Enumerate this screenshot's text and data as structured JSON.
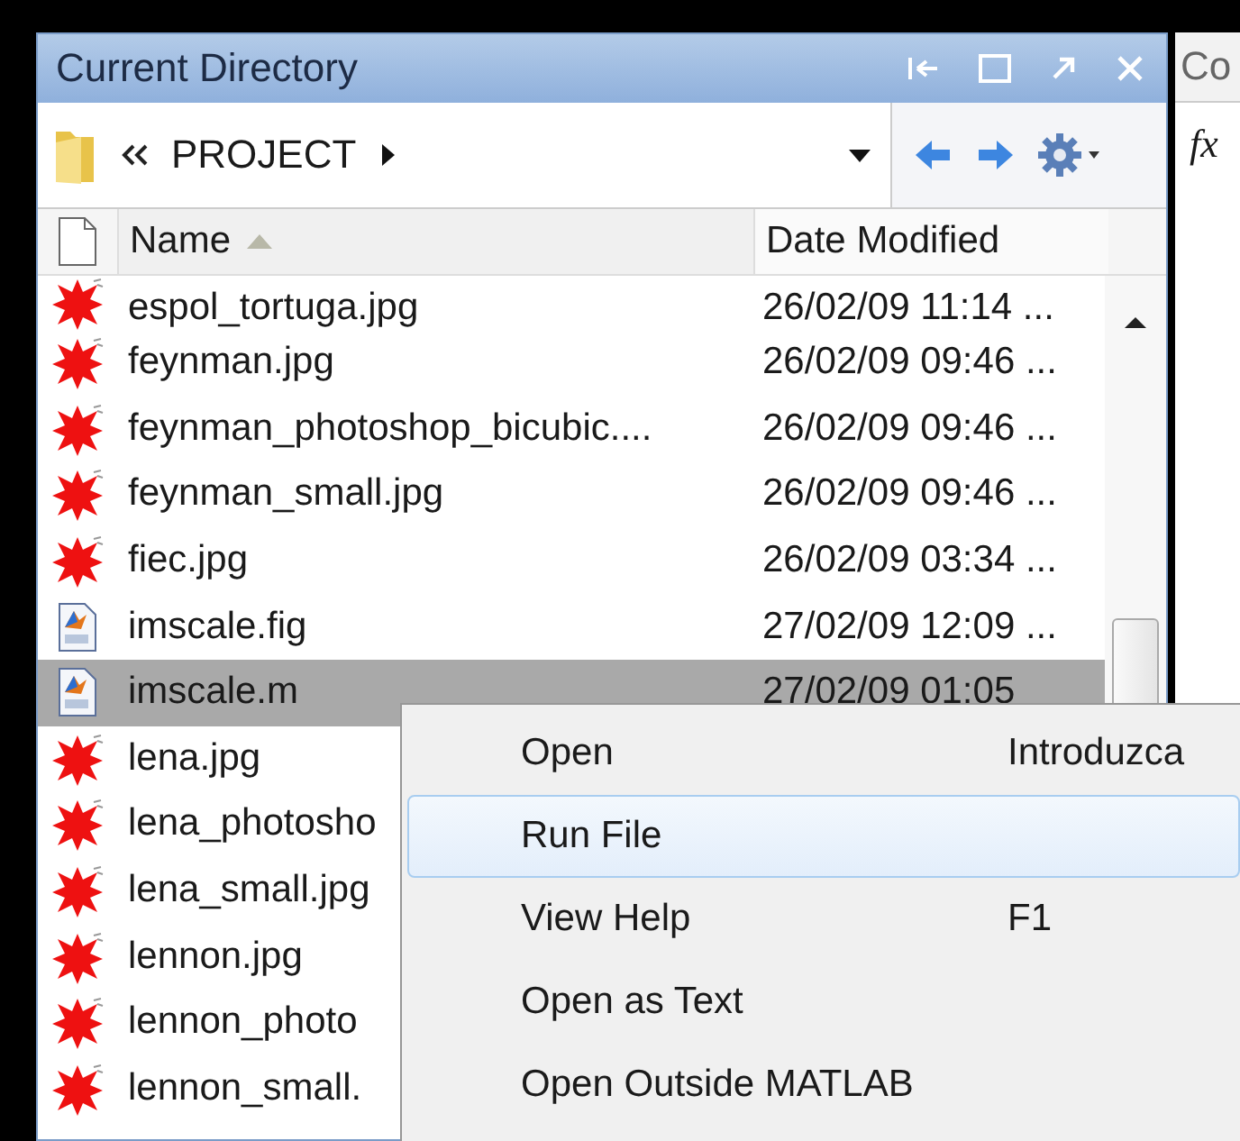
{
  "panel": {
    "title": "Current Directory"
  },
  "address": {
    "path": "PROJECT"
  },
  "columns": [
    {
      "label": "Name",
      "sorted": true
    },
    {
      "label": "Date Modified",
      "sorted": false
    }
  ],
  "rows": [
    {
      "name": "espol_tortuga.jpg",
      "date": "26/02/09 11:14 ...",
      "kind": "image",
      "selected": false
    },
    {
      "name": "feynman.jpg",
      "date": "26/02/09 09:46 ...",
      "kind": "image",
      "selected": false
    },
    {
      "name": "feynman_photoshop_bicubic....",
      "date": "26/02/09 09:46 ...",
      "kind": "image",
      "selected": false
    },
    {
      "name": "feynman_small.jpg",
      "date": "26/02/09 09:46 ...",
      "kind": "image",
      "selected": false
    },
    {
      "name": "fiec.jpg",
      "date": "26/02/09 03:34 ...",
      "kind": "image",
      "selected": false
    },
    {
      "name": "imscale.fig",
      "date": "27/02/09 12:09 ...",
      "kind": "matlab",
      "selected": false
    },
    {
      "name": "imscale.m",
      "date": "27/02/09 01:05",
      "kind": "matlab",
      "selected": true
    },
    {
      "name": "lena.jpg",
      "kind": "image",
      "selected": false
    },
    {
      "name": "lena_photosho",
      "kind": "image",
      "selected": false
    },
    {
      "name": "lena_small.jpg",
      "kind": "image",
      "selected": false
    },
    {
      "name": "lennon.jpg",
      "kind": "image",
      "selected": false
    },
    {
      "name": "lennon_photo",
      "kind": "image",
      "selected": false
    },
    {
      "name": "lennon_small.",
      "kind": "image",
      "selected": false
    }
  ],
  "side_panel": {
    "title": "Co",
    "symbol": "fx"
  },
  "context_menu": [
    {
      "label": "Open",
      "shortcut": "Introduzca",
      "selected": false
    },
    {
      "label": "Run File",
      "selected": true
    },
    {
      "label": "View Help",
      "shortcut": "F1",
      "selected": false
    },
    {
      "label": "Open as Text",
      "selected": false
    },
    {
      "label": "Open Outside MATLAB",
      "selected": false
    }
  ]
}
